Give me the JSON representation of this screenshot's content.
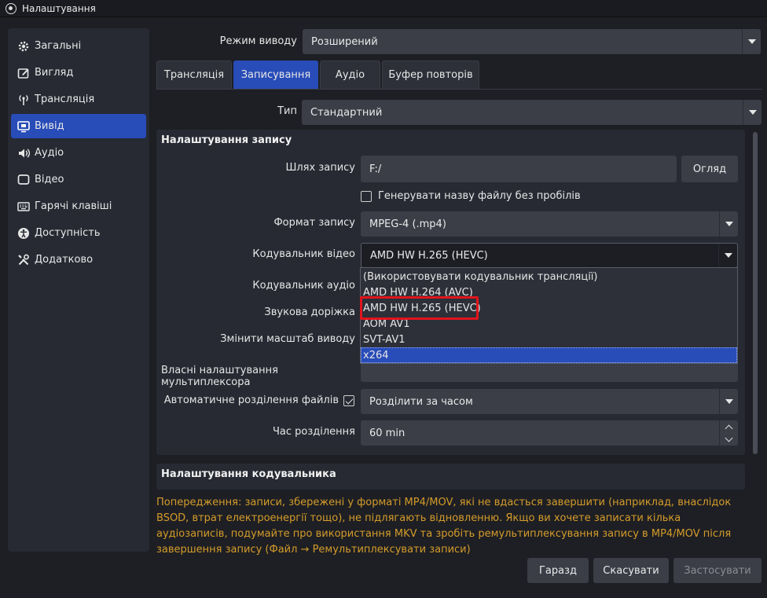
{
  "window": {
    "title": "Налаштування"
  },
  "sidebar": {
    "items": [
      {
        "label": "Загальні",
        "icon": "gear-icon"
      },
      {
        "label": "Вигляд",
        "icon": "appearance-icon"
      },
      {
        "label": "Трансляція",
        "icon": "broadcast-icon"
      },
      {
        "label": "Вивід",
        "icon": "output-icon",
        "active": true
      },
      {
        "label": "Аудіо",
        "icon": "speaker-icon"
      },
      {
        "label": "Відео",
        "icon": "monitor-icon"
      },
      {
        "label": "Гарячі клавіші",
        "icon": "keyboard-icon"
      },
      {
        "label": "Доступність",
        "icon": "accessibility-icon"
      },
      {
        "label": "Додатково",
        "icon": "tools-icon"
      }
    ]
  },
  "output_mode": {
    "label": "Режим виводу",
    "value": "Розширений"
  },
  "tabs": [
    {
      "label": "Трансляція"
    },
    {
      "label": "Записування",
      "active": true
    },
    {
      "label": "Аудіо"
    },
    {
      "label": "Буфер повторів"
    }
  ],
  "type": {
    "label": "Тип",
    "value": "Стандартний"
  },
  "recording": {
    "title": "Налаштування запису",
    "path_label": "Шлях запису",
    "path_value": "F:/",
    "browse_label": "Огляд",
    "no_spaces_label": "Генерувати назву файлу без пробілів",
    "format_label": "Формат запису",
    "format_value": "MPEG-4 (.mp4)",
    "video_encoder_label": "Кодувальник відео",
    "video_encoder_value": "AMD HW H.265 (HEVC)",
    "audio_encoder_label": "Кодувальник аудіо",
    "audio_track_label": "Звукова доріжка",
    "rescale_label": "Змінити масштаб виводу",
    "muxer_label": "Власні налаштування мультиплексора",
    "auto_split_label": "Автоматичне розділення файлів",
    "auto_split_checked": true,
    "split_mode_value": "Розділити за часом",
    "split_time_label": "Час розділення",
    "split_time_value": "60 min"
  },
  "encoder_dropdown": {
    "options": [
      "(Використовувати кодувальник трансляції)",
      "AMD HW H.264 (AVC)",
      "AMD HW H.265 (HEVC)",
      "AOM AV1",
      "SVT-AV1",
      "x264"
    ],
    "selected_index": 5,
    "highlighted_index": 2,
    "highlight_color": "#e0141c"
  },
  "encoder_settings": {
    "title": "Налаштування кодувальника"
  },
  "warning_text": "Попередження: записи, збережені у форматі MP4/MOV, які не вдасться завершити (наприклад, внаслідок BSOD, втрат електроенергії тощо), не підлягають відновленню. Якщо ви хочете записати кілька аудіозаписів, подумайте про використання MKV та зробіть ремультиплексування запису в MP4/MOV після завершення запису (Файл → Ремультиплексувати записи)",
  "footer": {
    "ok_label": "Гаразд",
    "cancel_label": "Скасувати",
    "apply_label": "Застосувати"
  },
  "colors": {
    "accent": "#284cb8",
    "warning": "#d49c2a",
    "background": "#1e1f24"
  }
}
